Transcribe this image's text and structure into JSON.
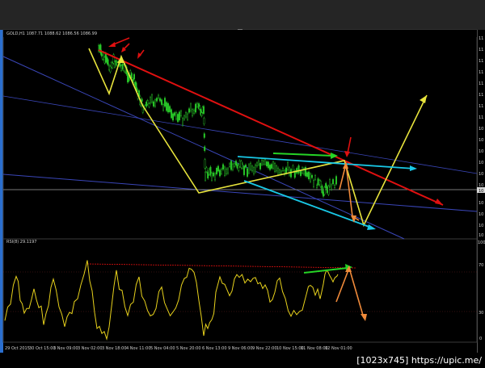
{
  "window": {
    "symbol_label": "GOLD,H1  1087.71 1088.62 1086.56 1086.99",
    "rsi_label": "RSI(8) 29.1197"
  },
  "price_axis": {
    "tick_labels": [
      "11",
      "11",
      "11",
      "11",
      "11",
      "11",
      "11",
      "11",
      "10",
      "10",
      "10",
      "10",
      "10",
      "10",
      "10",
      "10",
      "10",
      "10"
    ],
    "current_price_label": "10"
  },
  "rsi_axis": {
    "tick_labels": [
      "100",
      "70",
      "30",
      "0"
    ]
  },
  "time_axis": {
    "tick_labels": [
      "29 Oct 2015",
      "30 Oct 15:00",
      "3 Nov 09:00",
      "3 Nov 02:00",
      "3 Nov 18:00",
      "4 Nov 11:00",
      "5 Nov 04:00",
      "5 Nov 20:00",
      "6 Nov 13:00",
      "9 Nov 06:00",
      "9 Nov 22:00",
      "10 Nov 15:00",
      "11 Nov 08:00",
      "12 Nov 01:00"
    ]
  },
  "watermark": {
    "text": "[1023x745] https://upic.me/"
  },
  "colors": {
    "candles": "#28c828",
    "rsi_line": "#e8d21c",
    "trendline_red": "#e01010",
    "trendline_cyan": "#19c8e6",
    "zigzag_yellow": "#e8e43c",
    "arrow_green": "#26d426",
    "arrow_orange": "#f08a3a",
    "grid_blue": "#3a46b8"
  }
}
